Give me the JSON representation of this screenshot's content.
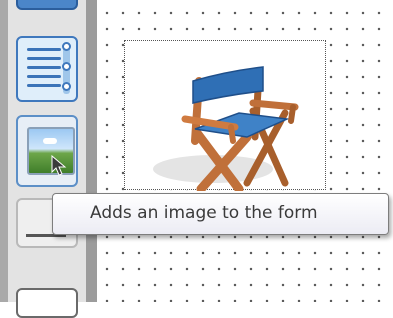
{
  "toolbox": {
    "tools": [
      {
        "name": "unknown-tool",
        "icon": "toolbox-tool-icon"
      },
      {
        "name": "list-box-tool",
        "icon": "list-box-icon"
      },
      {
        "name": "image-tool",
        "icon": "picture-icon"
      },
      {
        "name": "text-field-tool",
        "icon": "text-field-icon"
      },
      {
        "name": "unknown-tool",
        "icon": "toolbox-tool-icon"
      }
    ],
    "selected_tool": "image-tool"
  },
  "canvas": {
    "grid": true,
    "image_control": {
      "content_icon": "directors-chair-icon"
    }
  },
  "tooltip": {
    "text": "Adds an image to the form"
  },
  "colors": {
    "accent": "#3f78bd",
    "chair_canvas": "#2f6fb5",
    "chair_wood": "#c0703a",
    "tooltip_text": "#3a3a3a"
  }
}
